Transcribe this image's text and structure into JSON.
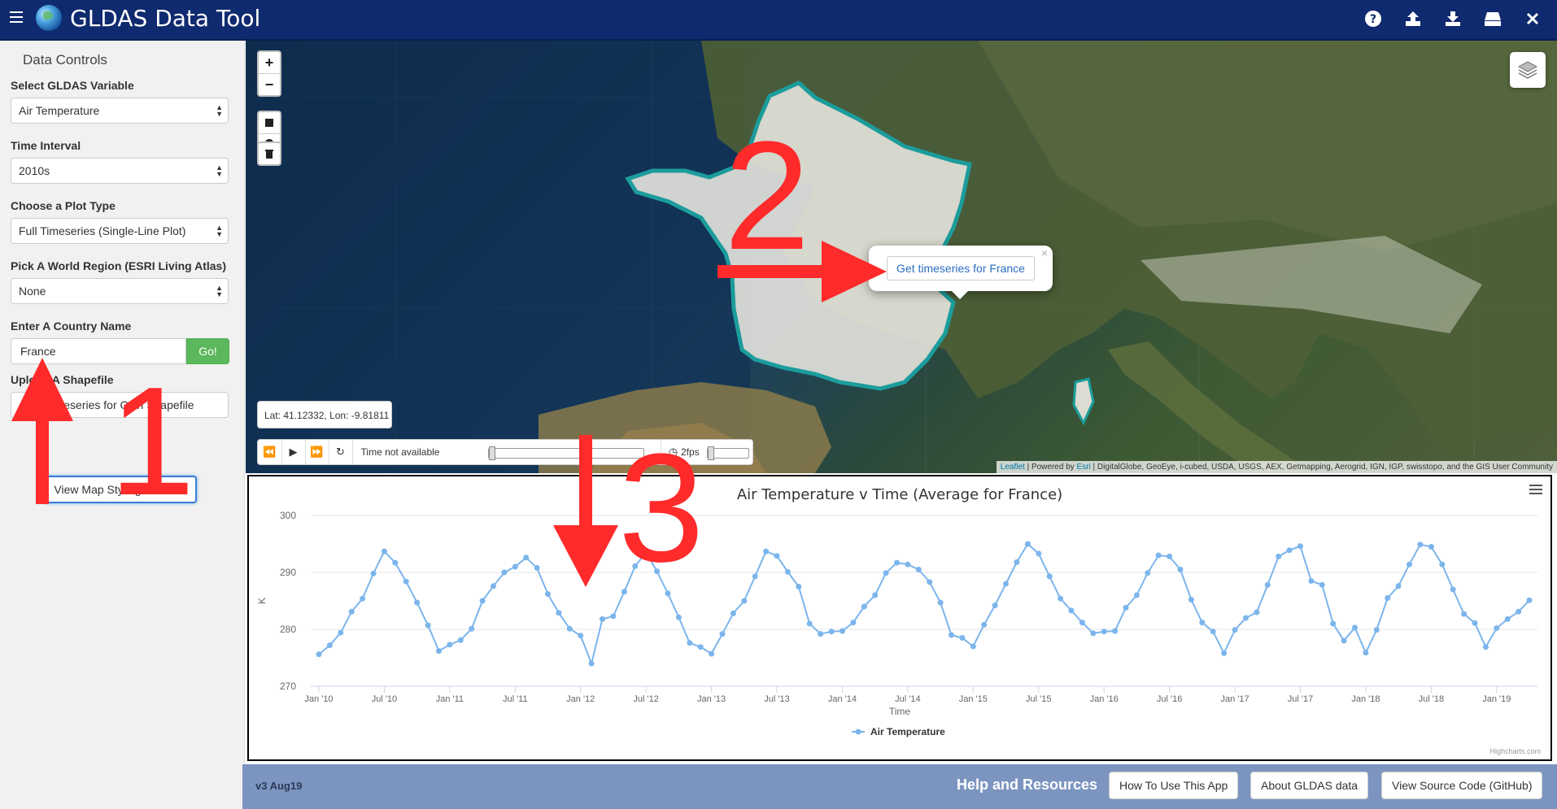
{
  "app": {
    "title": "GLDAS Data Tool"
  },
  "header_icons": [
    "help-icon",
    "upload-icon",
    "download-icon",
    "drive-icon",
    "close-icon"
  ],
  "sidebar": {
    "title": "Data Controls",
    "variable_label": "Select GLDAS Variable",
    "variable_value": "Air Temperature",
    "interval_label": "Time Interval",
    "interval_value": "2010s",
    "plot_label": "Choose a Plot Type",
    "plot_value": "Full Timeseries (Single-Line Plot)",
    "region_label": "Pick A World Region (ESRI Living Atlas)",
    "region_value": "None",
    "country_label": "Enter A Country Name",
    "country_value": "France",
    "go_label": "Go!",
    "shapefile_label": "Upload A Shapefile",
    "shapefile_button": "Timeseries for Own Shapefile",
    "style_button": "View Map Styling Controls"
  },
  "map": {
    "popup_button": "Get timeseries for France",
    "popup_close": "×",
    "latlon": "Lat: 41.12332, Lon: -9.81811",
    "time_status": "Time not available",
    "fps": "2fps",
    "attribution_leaflet": "Leaflet",
    "attribution_powered": " | Powered by ",
    "attribution_esri": "Esri",
    "attribution_rest": " | DigitalGlobe, GeoEye, i-cubed, USDA, USGS, AEX, Getmapping, Aerogrid, IGN, IGP, swisstopo, and the GIS User Community",
    "zoom_in": "+",
    "zoom_out": "−"
  },
  "annotations": {
    "one": "1",
    "two": "2",
    "three": "3"
  },
  "chart_data": {
    "type": "line",
    "title": "Air Temperature v Time (Average for France)",
    "xlabel": "Time",
    "ylabel": "K",
    "ylim": [
      270,
      300
    ],
    "yticks": [
      270,
      280,
      290,
      300
    ],
    "xticks": [
      "Jan '10",
      "Jul '10",
      "Jan '11",
      "Jul '11",
      "Jan '12",
      "Jul '12",
      "Jan '13",
      "Jul '13",
      "Jan '14",
      "Jul '14",
      "Jan '15",
      "Jul '15",
      "Jan '16",
      "Jul '16",
      "Jan '17",
      "Jul '17",
      "Jan '18",
      "Jul '18",
      "Jan '19"
    ],
    "credits": "Highcharts.com",
    "color": "#7cb5ec",
    "series": [
      {
        "name": "Air Temperature",
        "values": [
          275.6,
          277.2,
          279.4,
          283.1,
          285.4,
          289.8,
          293.7,
          291.7,
          288.4,
          284.7,
          280.7,
          276.2,
          277.3,
          278.1,
          280.1,
          285.0,
          287.6,
          290.0,
          291.0,
          292.6,
          290.8,
          286.2,
          282.9,
          280.1,
          278.9,
          274.0,
          281.8,
          282.3,
          286.6,
          291.1,
          293.5,
          290.2,
          286.3,
          282.1,
          277.6,
          276.9,
          275.7,
          279.2,
          282.8,
          285.0,
          289.3,
          293.7,
          292.9,
          290.1,
          287.5,
          281.0,
          279.2,
          279.6,
          279.7,
          281.2,
          284.0,
          286.0,
          289.9,
          291.7,
          291.4,
          290.5,
          288.3,
          284.7,
          279.0,
          278.5,
          277.0,
          280.8,
          284.2,
          288.0,
          291.8,
          295.0,
          293.3,
          289.3,
          285.4,
          283.3,
          281.2,
          279.3,
          279.6,
          279.7,
          283.8,
          286.0,
          289.9,
          293.0,
          292.8,
          290.5,
          285.2,
          281.2,
          279.6,
          275.8,
          279.9,
          282.0,
          283.0,
          287.8,
          292.8,
          293.9,
          294.6,
          288.5,
          287.8,
          281.0,
          278.0,
          280.3,
          275.9,
          279.9,
          285.5,
          287.6,
          291.4,
          294.9,
          294.5,
          291.4,
          287.0,
          282.7,
          281.1,
          276.9,
          280.2,
          281.8,
          283.1,
          285.1
        ]
      }
    ]
  },
  "footer": {
    "version": "v3 Aug19",
    "help_title": "Help and Resources",
    "btn_howto": "How To Use This App",
    "btn_about": "About GLDAS data",
    "btn_source": "View Source Code (GitHub)"
  }
}
